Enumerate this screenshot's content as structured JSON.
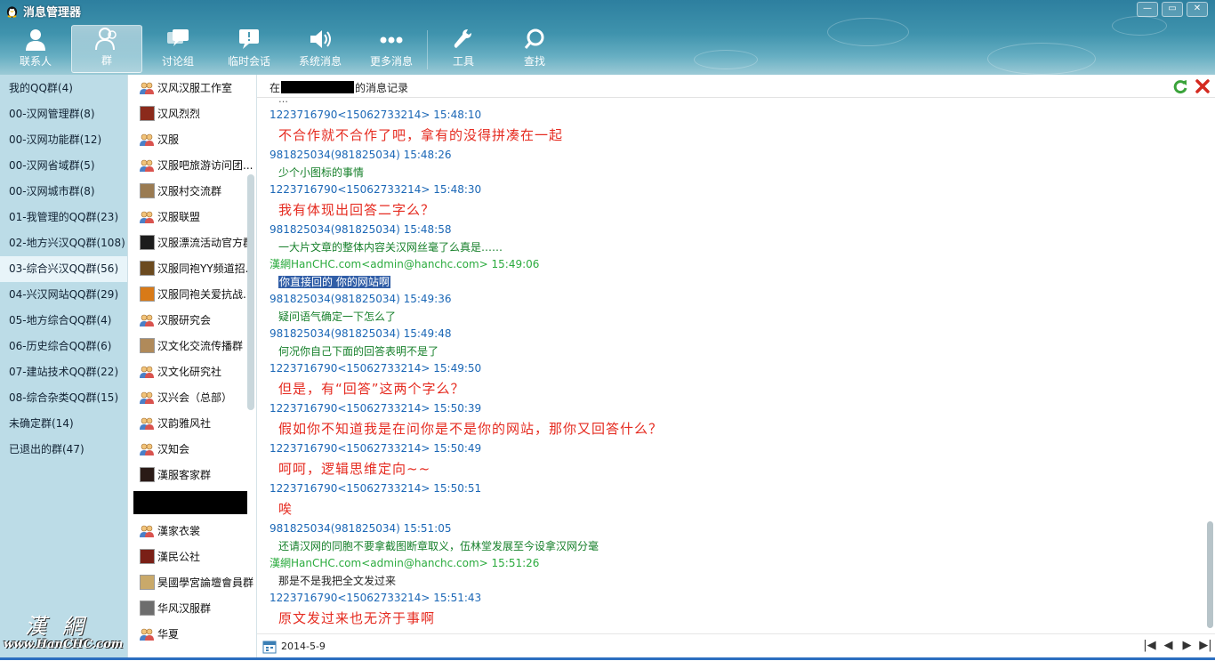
{
  "window": {
    "title": "消息管理器",
    "controls": [
      "—",
      "▭",
      "✕"
    ]
  },
  "toolbar": [
    {
      "label": "联系人",
      "icon": "person-icon"
    },
    {
      "label": "群",
      "icon": "group-icon",
      "active": true
    },
    {
      "label": "讨论组",
      "icon": "discussion-icon"
    },
    {
      "label": "临时会话",
      "icon": "temp-chat-icon"
    },
    {
      "label": "系统消息",
      "icon": "speaker-icon"
    },
    {
      "label": "更多消息",
      "icon": "more-dots-icon"
    },
    {
      "label": "工具",
      "icon": "wrench-icon"
    },
    {
      "label": "查找",
      "icon": "search-icon"
    }
  ],
  "categories": [
    {
      "label": "我的QQ群(4)"
    },
    {
      "label": "00-汉网管理群(8)"
    },
    {
      "label": "00-汉网功能群(12)"
    },
    {
      "label": "00-汉网省域群(5)"
    },
    {
      "label": "00-汉网城市群(8)"
    },
    {
      "label": "01-我管理的QQ群(23)"
    },
    {
      "label": "02-地方兴汉QQ群(108)"
    },
    {
      "label": "03-综合兴汉QQ群(56)",
      "selected": true
    },
    {
      "label": "04-兴汉网站QQ群(29)"
    },
    {
      "label": "05-地方综合QQ群(4)"
    },
    {
      "label": "06-历史综合QQ群(6)"
    },
    {
      "label": "07-建站技术QQ群(22)"
    },
    {
      "label": "08-综合杂类QQ群(15)"
    },
    {
      "label": "未确定群(14)"
    },
    {
      "label": "已退出的群(47)"
    }
  ],
  "logo": {
    "text": "漢網",
    "url": "www.HanCHC.com"
  },
  "groups": [
    {
      "name": "汉风汉服工作室",
      "icon": "people-icon"
    },
    {
      "name": "汉风烈烈",
      "icon": "avatar-photo-icon",
      "color": "#8b2a1b"
    },
    {
      "name": "汉服",
      "icon": "people-icon"
    },
    {
      "name": "汉服吧旅游访问团...",
      "icon": "people-icon"
    },
    {
      "name": "汉服村交流群",
      "icon": "avatar-photo-icon",
      "color": "#9a7b52"
    },
    {
      "name": "汉服联盟",
      "icon": "people-icon"
    },
    {
      "name": "汉服漂流活动官方群",
      "icon": "avatar-photo-icon",
      "color": "#1c1c1c"
    },
    {
      "name": "汉服同袍YY频道招...",
      "icon": "avatar-photo-icon",
      "color": "#6b4a1f"
    },
    {
      "name": "汉服同袍关爱抗战...",
      "icon": "avatar-photo-icon",
      "color": "#d87a18"
    },
    {
      "name": "汉服研究会",
      "icon": "people-icon"
    },
    {
      "name": "汉文化交流传播群",
      "icon": "avatar-photo-icon",
      "color": "#b08a5a"
    },
    {
      "name": "汉文化研究社",
      "icon": "people-icon"
    },
    {
      "name": "汉兴会（总部）",
      "icon": "people-icon"
    },
    {
      "name": "汉韵雅风社",
      "icon": "people-icon"
    },
    {
      "name": "汉知会",
      "icon": "people-icon"
    },
    {
      "name": "漢服客家群",
      "icon": "avatar-photo-icon",
      "color": "#2a1a16"
    },
    {
      "name": "",
      "redacted": true
    },
    {
      "name": "漢家衣裳",
      "icon": "people-icon"
    },
    {
      "name": "漢民公社",
      "icon": "avatar-photo-icon",
      "color": "#7a1f16"
    },
    {
      "name": "昊國學宮論壇會員群",
      "icon": "avatar-photo-icon",
      "color": "#c9a96a"
    },
    {
      "name": "华风汉服群",
      "icon": "avatar-photo-icon",
      "color": "#6d6d6d"
    },
    {
      "name": "华夏",
      "icon": "people-icon"
    }
  ],
  "message_header": {
    "prefix": "在",
    "suffix": "的消息记录"
  },
  "messages": [
    {
      "sender": "1223716790<15062733214> 15:48:10",
      "text": "不合作就不合作了吧，拿有的没得拼凑在一起",
      "style": "big"
    },
    {
      "sender": "981825034(981825034) 15:48:26",
      "text": "少个小图标的事情",
      "style": "small-green"
    },
    {
      "sender": "1223716790<15062733214> 15:48:30",
      "text": "我有体现出回答二字么？",
      "style": "big"
    },
    {
      "sender": "981825034(981825034) 15:48:58",
      "text": "一大片文章的整体内容关汉网丝毫了么真是……",
      "style": "small-green"
    },
    {
      "sender": "漢網HanCHC.com<admin@hanchc.com> 15:49:06",
      "sender_style": "green",
      "text": "你直接回的 你的网站啊",
      "style": "small-highlight"
    },
    {
      "sender": "981825034(981825034) 15:49:36",
      "text": "疑问语气确定一下怎么了",
      "style": "small-green"
    },
    {
      "sender": "981825034(981825034) 15:49:48",
      "text": "何况你自己下面的回答表明不是了",
      "style": "small-green"
    },
    {
      "sender": "1223716790<15062733214> 15:49:50",
      "text": "但是，有“回答”这两个字么？",
      "style": "big"
    },
    {
      "sender": "1223716790<15062733214> 15:50:39",
      "text": "假如你不知道我是在问你是不是你的网站，那你又回答什么？",
      "style": "big"
    },
    {
      "sender": "1223716790<15062733214> 15:50:49",
      "text": "呵呵，逻辑思维定向~~",
      "style": "big"
    },
    {
      "sender": "1223716790<15062733214> 15:50:51",
      "text": "唉",
      "style": "big"
    },
    {
      "sender": "981825034(981825034) 15:51:05",
      "text": "还请汉网的同胞不要拿截图断章取义，伍林堂发展至今设拿汉网分毫",
      "style": "small-green"
    },
    {
      "sender": "漢網HanCHC.com<admin@hanchc.com> 15:51:26",
      "sender_style": "green",
      "text": "那是不是我把全文发过来",
      "style": "small-dark"
    },
    {
      "sender": "1223716790<15062733214> 15:51:43",
      "text": "原文发过来也无济于事啊",
      "style": "big"
    }
  ],
  "footer": {
    "date": "2014-5-9",
    "pager": [
      "|◀",
      "◀",
      "▶",
      "▶|"
    ]
  },
  "colors": {
    "sender_blue": "#1b67b6",
    "sender_green": "#2bab3e",
    "msg_red": "#e52b20",
    "msg_green": "#17802b",
    "highlight": "#315ea7"
  }
}
